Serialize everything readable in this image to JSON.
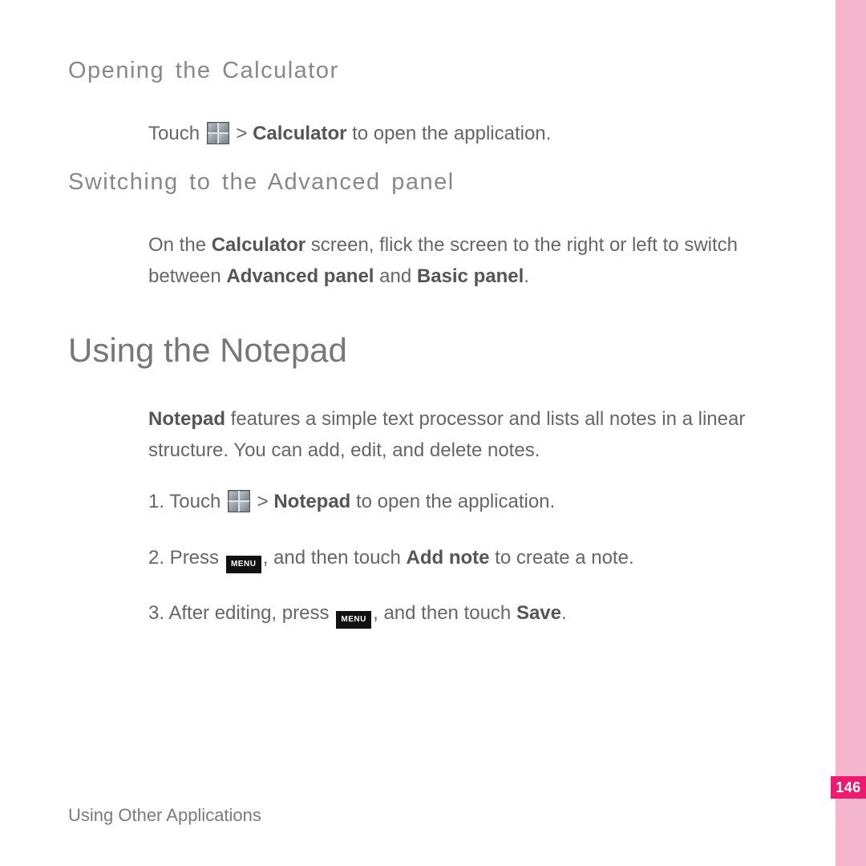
{
  "sections": {
    "calc_open": {
      "heading": "Opening the Calculator",
      "line_pre": "Touch ",
      "line_mid": " > ",
      "line_bold": "Calculator",
      "line_post": " to open the application."
    },
    "calc_adv": {
      "heading": "Switching to the Advanced panel",
      "p_pre": "On the ",
      "p_b1": "Calculator",
      "p_mid1": " screen, flick the screen to the right or left to switch between ",
      "p_b2": "Advanced panel",
      "p_mid2": " and ",
      "p_b3": "Basic panel",
      "p_post": "."
    },
    "notepad": {
      "heading": "Using the Notepad",
      "intro_b": "Notepad",
      "intro_rest": " features a simple text processor and lists all notes in a linear structure. You can add, edit, and delete notes.",
      "step1_pre": "1. Touch ",
      "step1_mid": " > ",
      "step1_b": "Notepad",
      "step1_post": " to open the application.",
      "step2_pre": "2. Press ",
      "step2_mid": ", and then touch ",
      "step2_b": "Add note",
      "step2_post": " to create a note.",
      "step3_pre": "3. After editing, press ",
      "step3_mid": ", and then touch ",
      "step3_b": "Save",
      "step3_post": "."
    }
  },
  "icons": {
    "menu_label": "MENU"
  },
  "footer": "Using Other Applications",
  "page_number": "146"
}
